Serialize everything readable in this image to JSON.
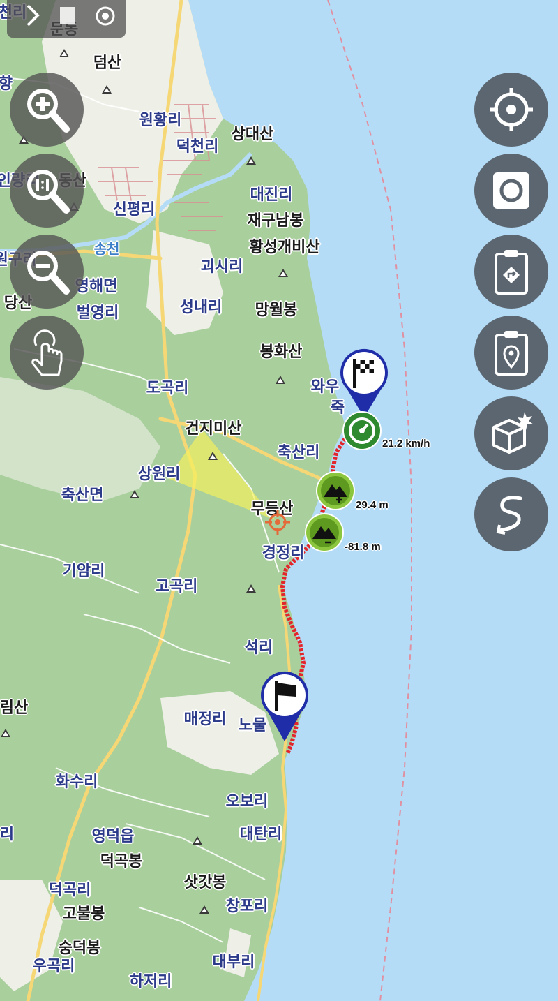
{
  "map": {
    "colors": {
      "sea": "#b5dcf7",
      "land": "#f1efe9",
      "forest": "#a9cf9d",
      "road_major": "#f6d776",
      "road_minor": "#ffffff",
      "route": "#e3262b"
    },
    "place_labels": [
      {
        "id": "deoksan",
        "text": "덤산",
        "kind": "peak"
      },
      {
        "id": "wonhwang",
        "text": "원황리",
        "kind": "village"
      },
      {
        "id": "deokcheon",
        "text": "덕천리",
        "kind": "village"
      },
      {
        "id": "sangdaesan",
        "text": "상대산",
        "kind": "peak"
      },
      {
        "id": "dongsan",
        "text": "동산",
        "kind": "peak"
      },
      {
        "id": "daejin",
        "text": "대진리",
        "kind": "village"
      },
      {
        "id": "jaegunambong",
        "text": "재구남봉",
        "kind": "peak"
      },
      {
        "id": "sinpyeong",
        "text": "신평리",
        "kind": "village"
      },
      {
        "id": "hwangseong",
        "text": "황성개비산",
        "kind": "peak"
      },
      {
        "id": "songcheon",
        "text": "송천",
        "kind": "water"
      },
      {
        "id": "gosi",
        "text": "괴시리",
        "kind": "village"
      },
      {
        "id": "yeonghae",
        "text": "영해면",
        "kind": "village"
      },
      {
        "id": "byeolyeong",
        "text": "벌영리",
        "kind": "village"
      },
      {
        "id": "seongnae",
        "text": "성내리",
        "kind": "village"
      },
      {
        "id": "mangwol",
        "text": "망월봉",
        "kind": "peak"
      },
      {
        "id": "danggsan",
        "text": "당산",
        "kind": "peak"
      },
      {
        "id": "bonghwa",
        "text": "봉화산",
        "kind": "peak"
      },
      {
        "id": "dogok",
        "text": "도곡리",
        "kind": "village"
      },
      {
        "id": "geonjimisan",
        "text": "건지미산",
        "kind": "peak"
      },
      {
        "id": "chuksan_ri",
        "text": "축산리",
        "kind": "village"
      },
      {
        "id": "sangwon",
        "text": "상원리",
        "kind": "village"
      },
      {
        "id": "chuksanmyeon",
        "text": "축산면",
        "kind": "village"
      },
      {
        "id": "mudeungsan",
        "text": "무등산",
        "kind": "peak"
      },
      {
        "id": "gyeongjeong",
        "text": "경정리",
        "kind": "village"
      },
      {
        "id": "giam",
        "text": "기암리",
        "kind": "village"
      },
      {
        "id": "gogok",
        "text": "고곡리",
        "kind": "village"
      },
      {
        "id": "seok",
        "text": "석리",
        "kind": "village"
      },
      {
        "id": "maejeong",
        "text": "매정리",
        "kind": "village"
      },
      {
        "id": "nomul",
        "text": "노물",
        "kind": "village"
      },
      {
        "id": "hwasu",
        "text": "화수리",
        "kind": "village"
      },
      {
        "id": "obo",
        "text": "오보리",
        "kind": "village"
      },
      {
        "id": "yeongdeok",
        "text": "영덕읍",
        "kind": "village"
      },
      {
        "id": "daetan",
        "text": "대탄리",
        "kind": "village"
      },
      {
        "id": "deokgokbong",
        "text": "덕곡봉",
        "kind": "peak"
      },
      {
        "id": "satgatbong",
        "text": "삿갓봉",
        "kind": "peak"
      },
      {
        "id": "deokgokri",
        "text": "덕곡리",
        "kind": "village"
      },
      {
        "id": "gobulbong",
        "text": "고불봉",
        "kind": "peak"
      },
      {
        "id": "changpo",
        "text": "창포리",
        "kind": "village"
      },
      {
        "id": "sungdeokbong",
        "text": "숭덕봉",
        "kind": "peak"
      },
      {
        "id": "ugok",
        "text": "우곡리",
        "kind": "village"
      },
      {
        "id": "daebu",
        "text": "대부리",
        "kind": "village"
      },
      {
        "id": "hajeo",
        "text": "하저리",
        "kind": "village"
      },
      {
        "id": "imsan",
        "text": "림산",
        "kind": "peak"
      },
      {
        "id": "wau",
        "text": "와우",
        "kind": "village"
      },
      {
        "id": "juk",
        "text": "죽",
        "kind": "village"
      },
      {
        "id": "mundong",
        "text": "문동",
        "kind": "village"
      },
      {
        "id": "cheonri",
        "text": "천리",
        "kind": "village"
      },
      {
        "id": "ingnyang",
        "text": "인량리",
        "kind": "village"
      },
      {
        "id": "wongu",
        "text": "원구리",
        "kind": "village"
      },
      {
        "id": "ri_left",
        "text": "리",
        "kind": "village"
      },
      {
        "id": "hyang",
        "text": "향",
        "kind": "village"
      }
    ],
    "markers": {
      "finish": {
        "icon": "checkered-flag-icon"
      },
      "start": {
        "icon": "start-flag-icon"
      },
      "speed": {
        "icon": "speedometer-icon",
        "label": "21.2 km/h"
      },
      "max_elevation": {
        "icon": "elevation-max-icon",
        "label": "29.4 m"
      },
      "min_elevation": {
        "icon": "elevation-min-icon",
        "label": "-81.8 m"
      },
      "position": {
        "icon": "crosshair-position-icon"
      }
    }
  },
  "controls": {
    "left": [
      {
        "id": "zoom-in",
        "icon": "zoom-in-icon"
      },
      {
        "id": "zoom-1-1",
        "icon": "zoom-1-1-icon"
      },
      {
        "id": "zoom-out",
        "icon": "zoom-out-icon"
      },
      {
        "id": "touch",
        "icon": "touch-icon"
      }
    ],
    "right": [
      {
        "id": "locate",
        "icon": "gps-target-icon"
      },
      {
        "id": "record",
        "icon": "record-stop-icon"
      },
      {
        "id": "route-clipboard",
        "icon": "route-clipboard-icon"
      },
      {
        "id": "poi-clipboard",
        "icon": "poi-clipboard-icon"
      },
      {
        "id": "new-box",
        "icon": "new-box-icon"
      },
      {
        "id": "track",
        "icon": "track-path-icon"
      }
    ],
    "top": [
      {
        "id": "top-1",
        "icon": "arrow-icon"
      },
      {
        "id": "top-2",
        "icon": "layer-icon"
      },
      {
        "id": "top-3",
        "icon": "rotate-icon"
      }
    ]
  }
}
